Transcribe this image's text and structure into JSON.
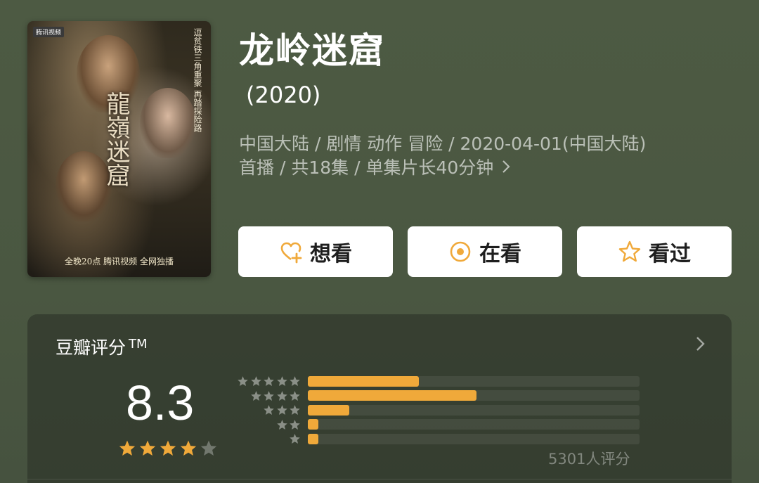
{
  "show": {
    "title": "龙岭迷窟",
    "year": "(2020)",
    "meta_line1": "中国大陆 / 剧情 动作 冒险 / 2020-04-01(中国大陆)",
    "meta_line2": "首播 / 共18集 / 单集片长40分钟"
  },
  "poster": {
    "title": "龍嶺迷窟",
    "tag": "腾讯视频",
    "side_text": "逗贫铁三角重聚 再踏探险路",
    "bottom_text": "全晚20点 腾讯视频 全网独播"
  },
  "actions": [
    {
      "label": "想看",
      "icon": "heart-plus-icon"
    },
    {
      "label": "在看",
      "icon": "circle-dot-icon"
    },
    {
      "label": "看过",
      "icon": "star-outline-icon"
    }
  ],
  "rating": {
    "title": "豆瓣评分",
    "tm": "TM",
    "score": "8.3",
    "stars": 4,
    "count_text": "5301人评分",
    "distribution": [
      {
        "stars": 5,
        "fraction": 0.335
      },
      {
        "stars": 4,
        "fraction": 0.508
      },
      {
        "stars": 3,
        "fraction": 0.125
      },
      {
        "stars": 2,
        "fraction": 0.032
      },
      {
        "stars": 1,
        "fraction": 0.032
      }
    ]
  },
  "colors": {
    "accent": "#f0a93a",
    "background": "#4a5741",
    "button_bg": "#ffffff",
    "button_icon": "#f0a93a"
  }
}
